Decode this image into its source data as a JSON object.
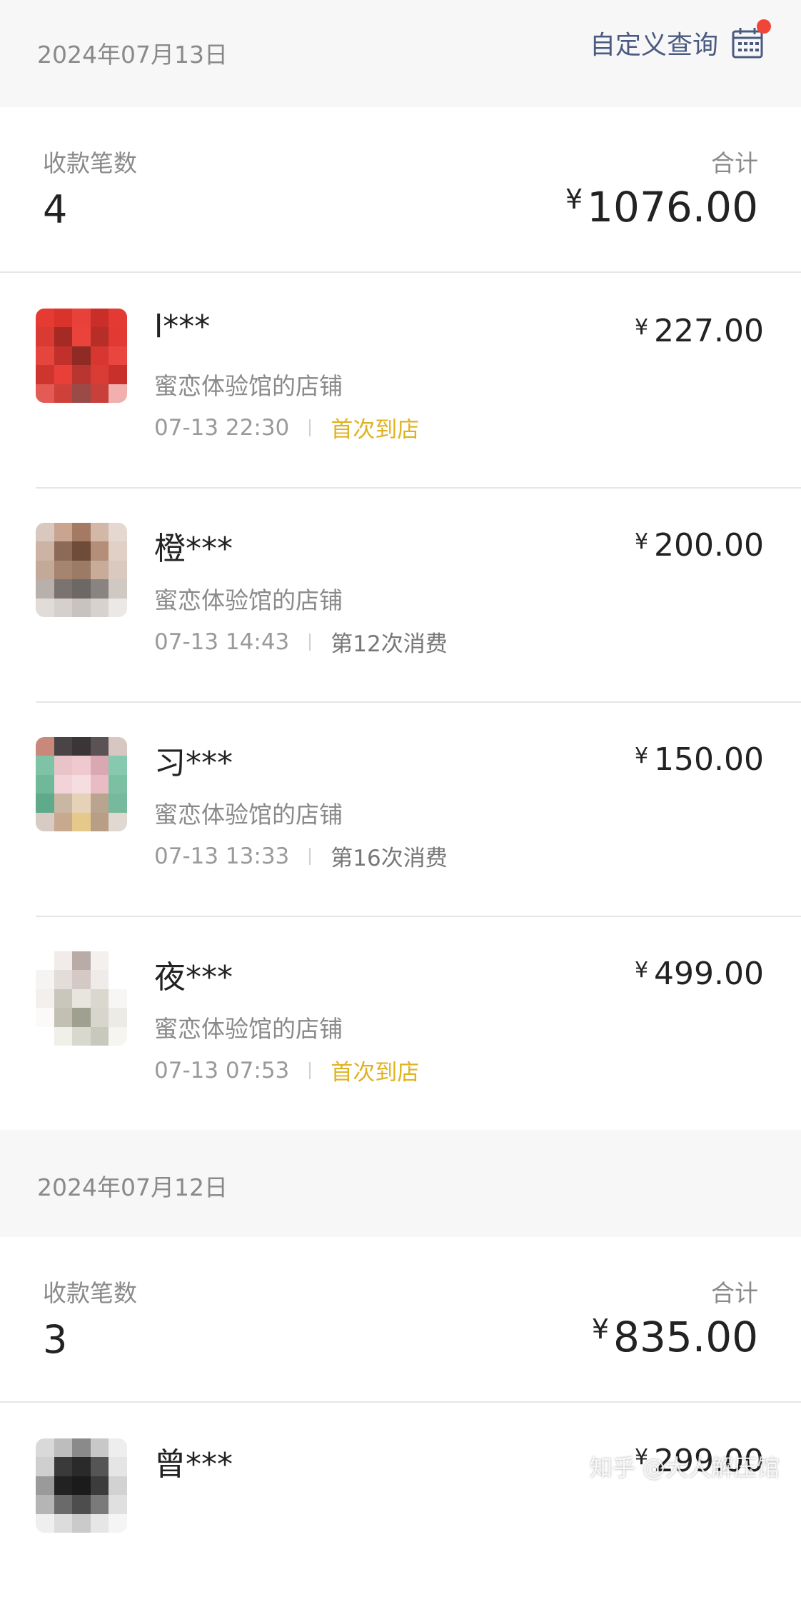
{
  "header": {
    "custom_query_label": "自定义查询",
    "calendar_icon": "calendar-icon",
    "notification_dot_color": "#f0463a"
  },
  "days": [
    {
      "date": "2024年07月13日",
      "count_label": "收款笔数",
      "count": "4",
      "total_label": "合计",
      "total_currency": "¥",
      "total": "1076.00",
      "transactions": [
        {
          "name": "l***",
          "shop": "蜜恋体验馆的店铺",
          "time": "07-13 22:30",
          "tag": "首次到店",
          "tag_type": "first",
          "currency": "¥",
          "amount": "227.00"
        },
        {
          "name": "橙***",
          "shop": "蜜恋体验馆的店铺",
          "time": "07-13 14:43",
          "tag": "第12次消费",
          "tag_type": "repeat",
          "currency": "¥",
          "amount": "200.00"
        },
        {
          "name": "习***",
          "shop": "蜜恋体验馆的店铺",
          "time": "07-13 13:33",
          "tag": "第16次消费",
          "tag_type": "repeat",
          "currency": "¥",
          "amount": "150.00"
        },
        {
          "name": "夜***",
          "shop": "蜜恋体验馆的店铺",
          "time": "07-13 07:53",
          "tag": "首次到店",
          "tag_type": "first",
          "currency": "¥",
          "amount": "499.00"
        }
      ]
    },
    {
      "date": "2024年07月12日",
      "count_label": "收款笔数",
      "count": "3",
      "total_label": "合计",
      "total_currency": "¥",
      "total": "835.00",
      "transactions": [
        {
          "name": "曾***",
          "currency": "¥",
          "amount": "299.00"
        }
      ]
    }
  ],
  "watermark": "知乎 @大人解压馆",
  "colors": {
    "first_visit_tag": "#e0b21f",
    "repeat_tag": "#777777",
    "link_blue": "#4a5a80"
  }
}
